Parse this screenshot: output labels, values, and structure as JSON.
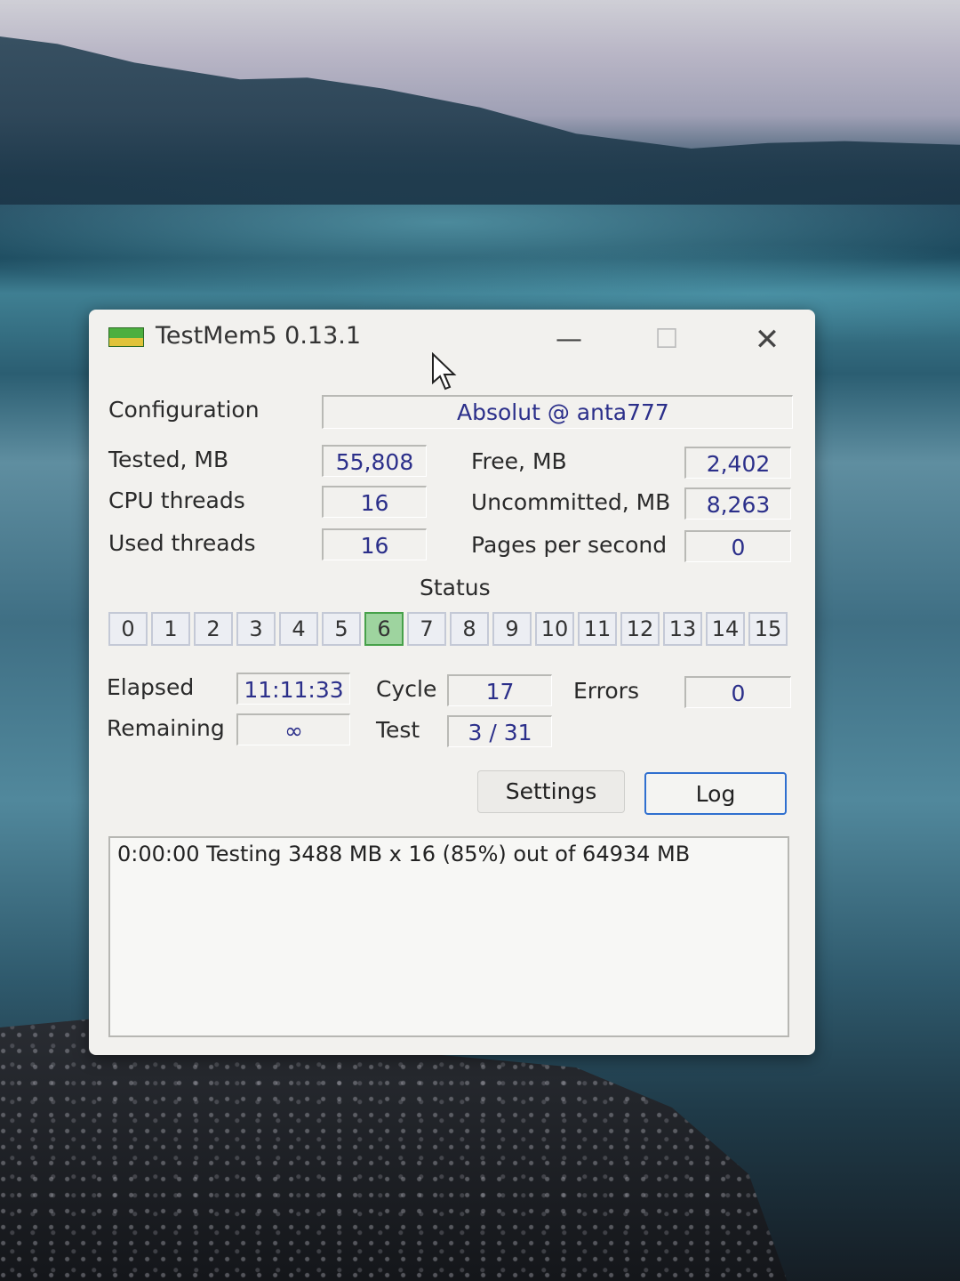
{
  "window": {
    "title": "TestMem5  0.13.1",
    "controls": {
      "minimize": "—",
      "maximize": "☐",
      "close": "✕"
    }
  },
  "config": {
    "label": "Configuration",
    "value": "Absolut @ anta777"
  },
  "stats_left": [
    {
      "label": "Tested, MB",
      "value": "55,808"
    },
    {
      "label": "CPU threads",
      "value": "16"
    },
    {
      "label": "Used threads",
      "value": "16"
    }
  ],
  "stats_right": [
    {
      "label": "Free, MB",
      "value": "2,402"
    },
    {
      "label": "Uncommitted, MB",
      "value": "8,263"
    },
    {
      "label": "Pages per second",
      "value": "0"
    }
  ],
  "status": {
    "label": "Status",
    "threads": [
      "0",
      "1",
      "2",
      "3",
      "4",
      "5",
      "6",
      "7",
      "8",
      "9",
      "10",
      "11",
      "12",
      "13",
      "14",
      "15"
    ],
    "active_thread": "6"
  },
  "progress": {
    "elapsed_label": "Elapsed",
    "elapsed": "11:11:33",
    "remaining_label": "Remaining",
    "remaining": "∞",
    "cycle_label": "Cycle",
    "cycle": "17",
    "test_label": "Test",
    "test": "3 / 31",
    "errors_label": "Errors",
    "errors": "0"
  },
  "buttons": {
    "settings": "Settings",
    "log": "Log"
  },
  "log_lines": [
    "0:00:00  Testing 3488 MB x 16 (85%) out of 64934 MB"
  ],
  "colors": {
    "value_text": "#2b2f8a",
    "active_thread": "#9ed49f",
    "log_button_border": "#2f6fcf"
  }
}
